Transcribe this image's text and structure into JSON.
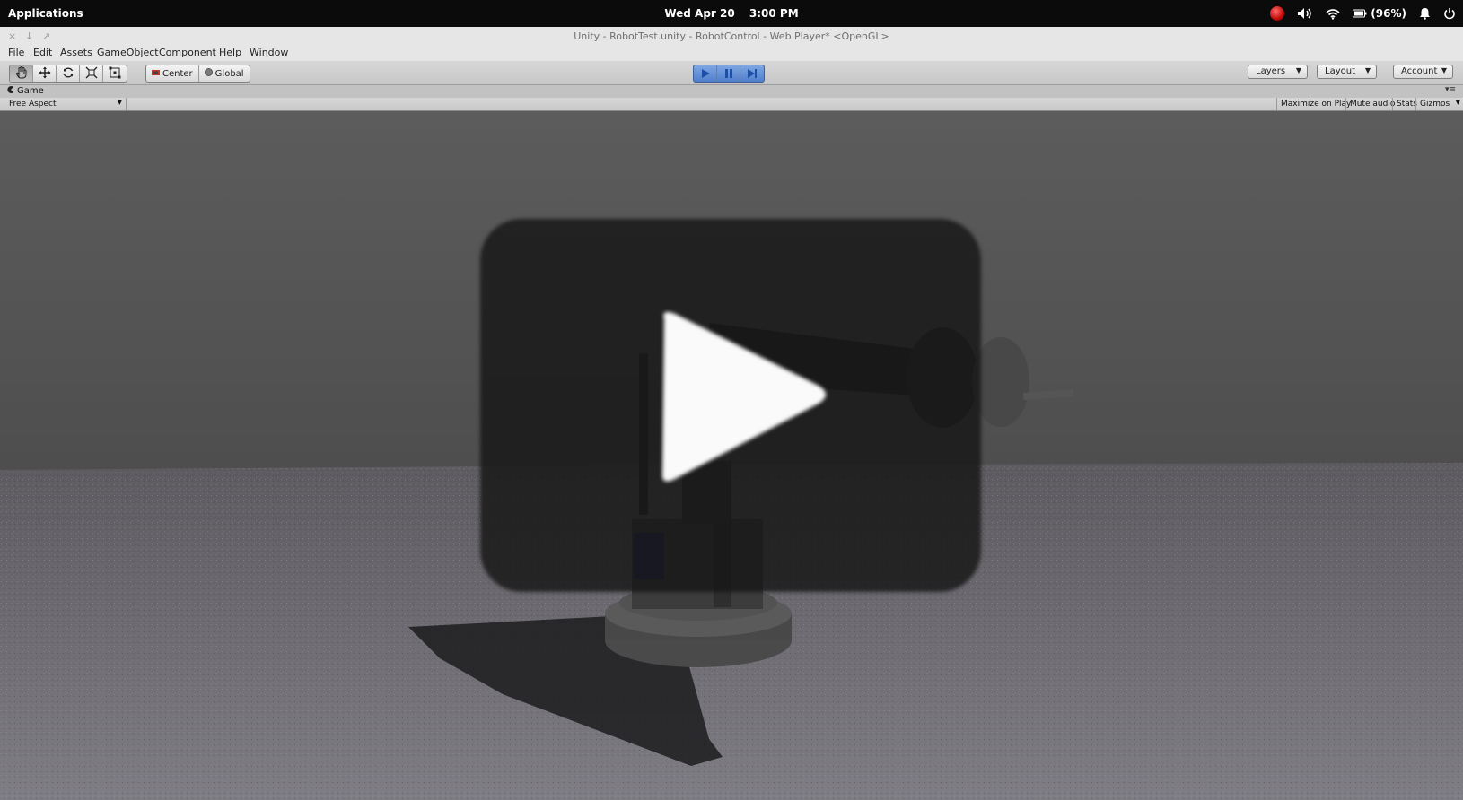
{
  "os_bar": {
    "applications_label": "Applications",
    "date": "Wed Apr 20",
    "time": "3:00 PM",
    "battery_text": "(96%)",
    "icons": [
      "record-icon",
      "volume-icon",
      "wifi-icon",
      "battery-icon",
      "notification-bell-icon",
      "power-icon"
    ]
  },
  "window": {
    "title": "Unity - RobotTest.unity - RobotControl - Web Player* <OpenGL>",
    "buttons": {
      "close": "×",
      "minimize": "↓",
      "maximize": "↗"
    }
  },
  "menu": {
    "items": [
      "File",
      "Edit",
      "Assets",
      "GameObject",
      "Component",
      "Help",
      "Window"
    ]
  },
  "toolbar": {
    "transform_tools": [
      "hand-tool-icon",
      "move-tool-icon",
      "rotate-tool-icon",
      "scale-tool-icon",
      "rect-tool-icon"
    ],
    "pivot_label": "Center",
    "space_label": "Global",
    "layers_label": "Layers",
    "layout_label": "Layout",
    "account_label": "Account",
    "play_state": "playing",
    "accent_color": "#3e72c8"
  },
  "game_view": {
    "tab_label": "Game",
    "aspect_label": "Free Aspect",
    "maximize_label": "Maximize on Play",
    "mute_label": "Mute audio",
    "stats_label": "Stats",
    "gizmos_label": "Gizmos"
  },
  "scene": {
    "description_icon": "play-overlay-icon"
  }
}
